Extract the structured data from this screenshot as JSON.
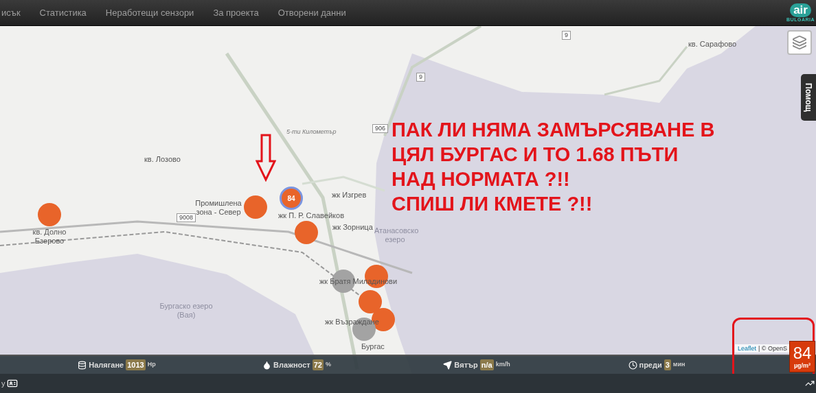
{
  "nav": {
    "items": [
      {
        "label": "исък",
        "selected": false
      },
      {
        "label": "Статистика",
        "selected": false
      },
      {
        "label": "Неработещи сензори",
        "selected": false
      },
      {
        "label": "За проекта",
        "selected": false
      },
      {
        "label": "Отворени данни",
        "selected": false
      }
    ],
    "logo": {
      "mark": "air",
      "sub": "BULGARIA"
    }
  },
  "map": {
    "labels": [
      {
        "text": "кв. Сарафово",
        "kind": "place"
      },
      {
        "text": "кв. Лозово",
        "kind": "place"
      },
      {
        "text": "кв. Долно Езерово",
        "kind": "place"
      },
      {
        "text": "Промишлена зона - Север",
        "kind": "place"
      },
      {
        "text": "жк Изгрев",
        "kind": "place"
      },
      {
        "text": "жк П. Р. Славейков",
        "kind": "place"
      },
      {
        "text": "жк Зорница",
        "kind": "place"
      },
      {
        "text": "жк Братя Миладинови",
        "kind": "place"
      },
      {
        "text": "жк Възраждане",
        "kind": "place"
      },
      {
        "text": "Бургас",
        "kind": "place"
      },
      {
        "text": "Бургаско езеро (Вая)",
        "kind": "water"
      },
      {
        "text": "Атанасовско езеро",
        "kind": "water"
      },
      {
        "text": "5-ти Километър",
        "kind": "minor"
      }
    ],
    "route_shields": [
      "9",
      "906",
      "9",
      "9008"
    ],
    "markers": [
      {
        "color": "#e8642a"
      },
      {
        "color": "#e8642a"
      },
      {
        "color": "#e8642a",
        "label": "84",
        "kind": "cluster"
      },
      {
        "color": "#e8642a"
      },
      {
        "color": "#e8642a"
      },
      {
        "color": "#a3a3a3"
      },
      {
        "color": "#e8642a"
      },
      {
        "color": "#e8642a"
      },
      {
        "color": "#a3a3a3"
      }
    ],
    "annotation": {
      "lines": [
        "ПАК ЛИ НЯМА ЗАМЪРСЯВАНЕ В",
        "ЦЯЛ БУРГАС И ТО 1.68 ПЪТИ",
        "НАД НОРМАТА ?!!",
        "СПИШ ЛИ КМЕТЕ ?!!"
      ]
    },
    "help_tab": "Помощ",
    "attribution": {
      "link": "Leaflet",
      "rest": "| © OpenS"
    }
  },
  "stats": [
    {
      "kind": "pressure",
      "label": "Налягане",
      "value": "1013",
      "unit": "Hp"
    },
    {
      "kind": "humidity",
      "label": "Влажност",
      "value": "72",
      "unit": "%"
    },
    {
      "kind": "wind",
      "label": "Вятър",
      "value": "n/a",
      "unit": "km/h"
    },
    {
      "kind": "time",
      "label": "преди",
      "value": "3",
      "unit": "мин"
    }
  ],
  "legend": {
    "value": "84",
    "unit": "µg/m³"
  },
  "footer": {
    "left_text": "у"
  }
}
